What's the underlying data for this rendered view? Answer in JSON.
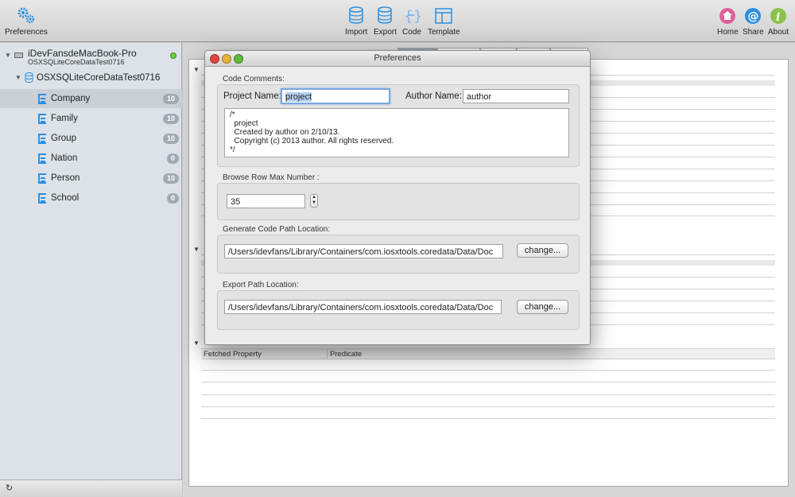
{
  "toolbar": {
    "preferences_label": "Preferences",
    "import_label": "Import",
    "export_label": "Export",
    "code_label": "Code",
    "template_label": "Template",
    "home_label": "Home",
    "share_label": "Share",
    "about_label": "About"
  },
  "sidebar": {
    "device_name": "iDevFansdeMacBook-Pro",
    "device_sub": "OSXSQLiteCoreDataTest0716",
    "database_name": "OSXSQLiteCoreDataTest0716",
    "entities": [
      {
        "name": "Company",
        "count": "10"
      },
      {
        "name": "Family",
        "count": "10"
      },
      {
        "name": "Group",
        "count": "10"
      },
      {
        "name": "Nation",
        "count": "0"
      },
      {
        "name": "Person",
        "count": "10"
      },
      {
        "name": "School",
        "count": "0"
      }
    ]
  },
  "background_table": {
    "fetched_property_header": "Fetched Property",
    "predicate_header": "Predicate"
  },
  "dialog": {
    "title": "Preferences",
    "code_comments_label": "Code Comments:",
    "project_name_label": "Project Name:",
    "project_name_value": "project",
    "author_name_label": "Author Name:",
    "author_name_value": "author",
    "comment_text": "/*\n  project\n  Created by author on 2/10/13.\n  Copyright (c) 2013 author. All rights reserved.\n*/",
    "browse_row_label": "Browse Row Max Number :",
    "browse_row_value": "35",
    "code_path_label": "Generate Code Path Location:",
    "code_path_value": "/Users/idevfans/Library/Containers/com.iosxtools.coredata/Data/Doc",
    "code_path_button": "change...",
    "export_path_label": "Export Path Location:",
    "export_path_value": "/Users/idevfans/Library/Containers/com.iosxtools.coredata/Data/Doc",
    "export_path_button": "change..."
  },
  "colors": {
    "accent": "#2b8fe0",
    "selection": "#b3d1f5",
    "home": "#e0609a",
    "share": "#2a8fe0",
    "about": "#8bc34a"
  }
}
